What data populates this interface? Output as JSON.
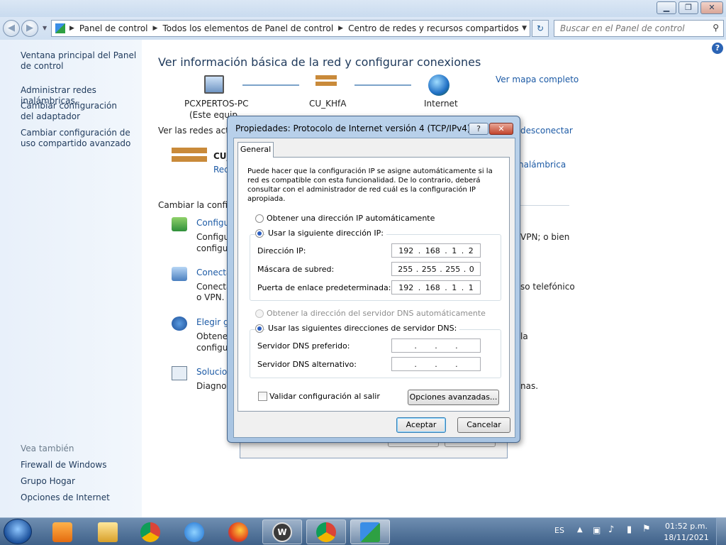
{
  "window": {
    "minimize": "▁",
    "maximize": "❐",
    "close": "✕"
  },
  "address": {
    "crumbs": [
      "Panel de control",
      "Todos los elementos de Panel de control",
      "Centro de redes y recursos compartidos"
    ],
    "search_placeholder": "Buscar en el Panel de control"
  },
  "sidebar": {
    "links": [
      "Ventana principal del Panel de control",
      "Administrar redes inalámbricas",
      "Cambiar configuración del adaptador",
      "Cambiar configuración de uso compartido avanzado"
    ],
    "see_also_title": "Vea también",
    "see_also": [
      "Firewall de Windows",
      "Grupo Hogar",
      "Opciones de Internet"
    ]
  },
  "main": {
    "title": "Ver información básica de la red y configurar conexiones",
    "full_map": "Ver mapa completo",
    "nodes": [
      {
        "name": "PCXPERTOS-PC",
        "sub": "(Este equip"
      },
      {
        "name": "CU_KHfA",
        "sub": ""
      },
      {
        "name": "Internet",
        "sub": ""
      }
    ],
    "active_label": "Ver las redes activa",
    "disconnect": "desconectar",
    "network_name": "CU_",
    "network_type": "Red",
    "wireless": "nalámbrica",
    "change_label": "Cambiar la configu",
    "tasks": [
      {
        "link": "Configu",
        "desc1": "Configu",
        "desc2": "configu",
        "tail": "VPN; o bien"
      },
      {
        "link": "Conecta",
        "desc1": "Conecta",
        "desc2": "o VPN.",
        "tail": "so telefónico"
      },
      {
        "link": "Elegir gr",
        "desc1": "Obtener",
        "desc2": "configu",
        "tail": "la"
      },
      {
        "link": "Solucion",
        "desc1": "Diagnos",
        "desc2": "",
        "tail": "nas."
      }
    ]
  },
  "dialog": {
    "title": "Propiedades: Protocolo de Internet versión 4 (TCP/IPv4)",
    "help": "?",
    "close": "✕",
    "tab": "General",
    "description": "Puede hacer que la configuración IP se asigne automáticamente si la red es compatible con esta funcionalidad. De lo contrario, deberá consultar con el administrador de red cuál es la configuración IP apropiada.",
    "ip_auto": "Obtener una dirección IP automáticamente",
    "ip_manual": "Usar la siguiente dirección IP:",
    "ip_label": "Dirección IP:",
    "ip_value": [
      "192",
      "168",
      "1",
      "2"
    ],
    "mask_label": "Máscara de subred:",
    "mask_value": [
      "255",
      "255",
      "255",
      "0"
    ],
    "gateway_label": "Puerta de enlace predeterminada:",
    "gateway_value": [
      "192",
      "168",
      "1",
      "1"
    ],
    "dns_auto": "Obtener la dirección del servidor DNS automáticamente",
    "dns_manual": "Usar las siguientes direcciones de servidor DNS:",
    "dns_pref_label": "Servidor DNS preferido:",
    "dns_alt_label": "Servidor DNS alternativo:",
    "validate": "Validar configuración al salir",
    "advanced": "Opciones avanzadas...",
    "ok": "Aceptar",
    "cancel": "Cancelar"
  },
  "taskbar": {
    "lang": "ES",
    "time": "01:52 p.m.",
    "date": "18/11/2021"
  }
}
